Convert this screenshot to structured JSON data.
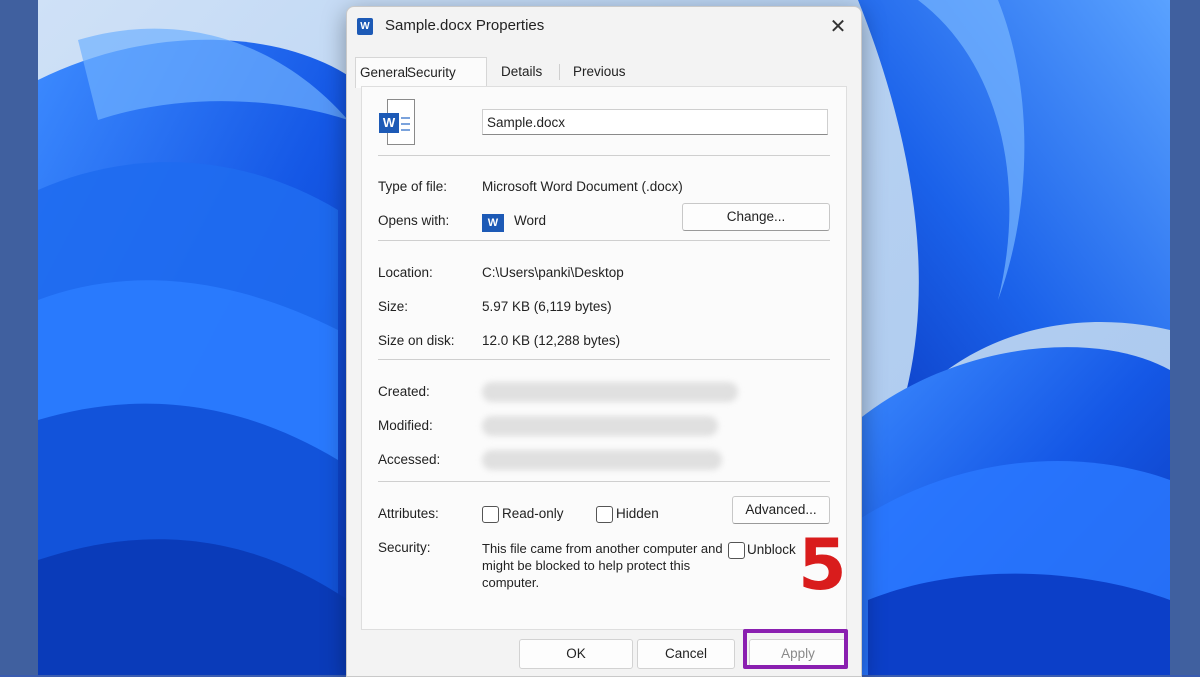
{
  "window": {
    "title": "Sample.docx Properties",
    "app_icon_letter": "W",
    "close_glyph": "✕"
  },
  "tabs": [
    {
      "label": "General"
    },
    {
      "label": "Security"
    },
    {
      "label": "Details"
    },
    {
      "label": "Previous Versions"
    }
  ],
  "file": {
    "icon": "word-document-icon",
    "name": "Sample.docx",
    "type_label": "Type of file:",
    "type_value": "Microsoft Word Document (.docx)",
    "opens_label": "Opens with:",
    "opens_app": "Word",
    "change_button": "Change...",
    "location_label": "Location:",
    "location_value": "C:\\Users\\panki\\Desktop",
    "size_label": "Size:",
    "size_value": "5.97 KB (6,119 bytes)",
    "size_on_disk_label": "Size on disk:",
    "size_on_disk_value": "12.0 KB (12,288 bytes)",
    "created_label": "Created:",
    "modified_label": "Modified:",
    "accessed_label": "Accessed:"
  },
  "attributes": {
    "label": "Attributes:",
    "readonly_label": "Read-only",
    "readonly_checked": false,
    "hidden_label": "Hidden",
    "hidden_checked": false,
    "advanced_button": "Advanced..."
  },
  "security": {
    "label": "Security:",
    "text": "This file came from another computer and might be blocked to help protect this computer.",
    "unblock_label": "Unblock",
    "unblock_checked": false
  },
  "footer": {
    "ok": "OK",
    "cancel": "Cancel",
    "apply": "Apply"
  },
  "annotation": {
    "step_number": "5",
    "step_color": "#d91c1c",
    "highlight_color": "#8a1fb0"
  },
  "colors": {
    "word_blue": "#1d5ab6",
    "wallpaper_blue": "#1a5de0"
  }
}
